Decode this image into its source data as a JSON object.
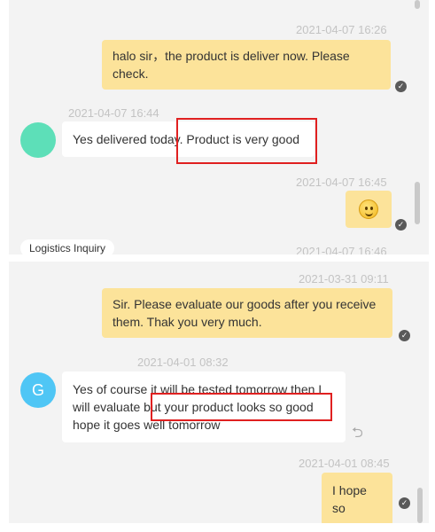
{
  "panel1": {
    "messages": [
      {
        "timestamp": "2021-04-07 16:26",
        "text": "halo sir，the product is deliver now. Please check."
      },
      {
        "timestamp": "2021-04-07 16:44",
        "text": "Yes delivered today. Product is very good"
      },
      {
        "timestamp": "2021-04-07 16:45"
      },
      {
        "timestamp": "2021-04-07 16:46"
      }
    ],
    "chip": "Logistics Inquiry"
  },
  "panel2": {
    "messages": [
      {
        "timestamp": "2021-03-31 09:11",
        "text": "Sir. Please evaluate our goods after you receive them. Thak you very much."
      },
      {
        "timestamp": "2021-04-01 08:32",
        "text": "Yes of course it will be tested tomorrow then I will evaluate but your product looks so good hope it goes well tomorrow"
      },
      {
        "timestamp": "2021-04-01 08:45",
        "text": "I hope so"
      }
    ],
    "avatar_letter": "G"
  },
  "colors": {
    "outgoing_bubble": "#fce39a",
    "incoming_bubble": "#ffffff",
    "panel_background": "#f3f3f3",
    "avatar_green": "#5ddfb8",
    "avatar_blue": "#4fc6f5",
    "highlight_red": "#e02020"
  },
  "icons": [
    "read-check-icon",
    "smiley-emoji-icon",
    "reply-icon"
  ]
}
